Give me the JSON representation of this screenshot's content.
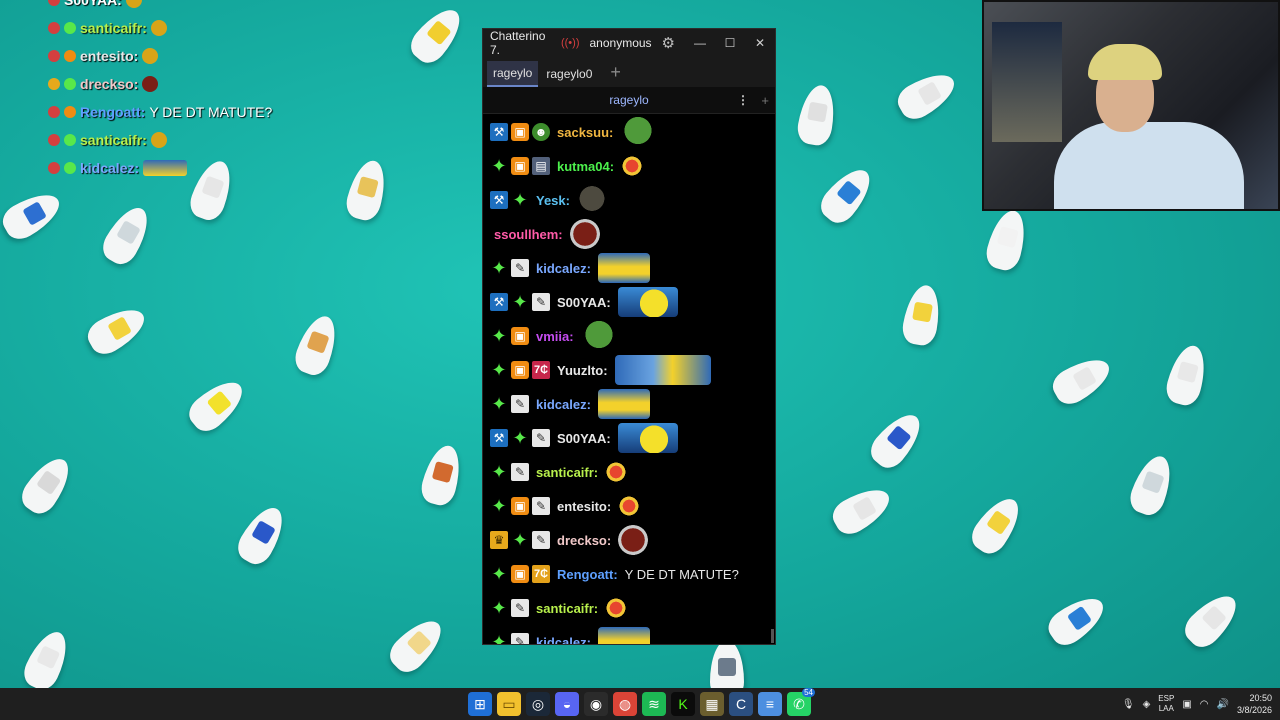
{
  "window": {
    "title": "Chatterino 7.",
    "live_icon": "broadcast-icon",
    "account": "anonymous",
    "minimize": "—",
    "maximize": "☐",
    "close": "✕"
  },
  "tabs": [
    {
      "label": "rageylo",
      "active": true
    },
    {
      "label": "rageylo0",
      "active": false
    }
  ],
  "tab_add": "+",
  "split": {
    "channel": "rageylo",
    "menu": "⋮",
    "add": "+"
  },
  "messages": [
    {
      "badges": [
        "mod",
        "box",
        "frog"
      ],
      "user": "sacksuu:",
      "color": "#f0b640",
      "text": "",
      "emote": "pepe"
    },
    {
      "badges": [
        "sub",
        "box",
        "img"
      ],
      "user": "kutma04:",
      "color": "#4cf04c",
      "text": "",
      "emote": "small"
    },
    {
      "badges": [
        "mod",
        "sub"
      ],
      "user": "Yesk:",
      "color": "#5bc0f0",
      "text": "",
      "emote": "cat"
    },
    {
      "badges": [],
      "user": "ssoullhem:",
      "color": "#ff5ba8",
      "text": "",
      "emote": "cookie"
    },
    {
      "badges": [
        "sub",
        "pencil"
      ],
      "user": "kidcalez:",
      "color": "#7aa8ff",
      "text": "",
      "emote": "minion"
    },
    {
      "badges": [
        "mod",
        "sub",
        "pencil"
      ],
      "user": "S00YAA:",
      "color": "#e8e8e8",
      "text": "",
      "emote": "duck"
    },
    {
      "badges": [
        "sub",
        "box"
      ],
      "user": "vmiia:",
      "color": "#c54cf0",
      "text": "",
      "emote": "pepe"
    },
    {
      "badges": [
        "sub",
        "box",
        "seven"
      ],
      "user": "Yuuzlto:",
      "color": "#e8e8e8",
      "text": "",
      "emote": "wide"
    },
    {
      "badges": [
        "sub",
        "pencil"
      ],
      "user": "kidcalez:",
      "color": "#7aa8ff",
      "text": "",
      "emote": "minion"
    },
    {
      "badges": [
        "mod",
        "sub",
        "pencil"
      ],
      "user": "S00YAA:",
      "color": "#e8e8e8",
      "text": "",
      "emote": "duck"
    },
    {
      "badges": [
        "sub",
        "pencil"
      ],
      "user": "santicaifr:",
      "color": "#b8f04c",
      "text": "",
      "emote": "small"
    },
    {
      "badges": [
        "sub",
        "box",
        "pencil"
      ],
      "user": "entesito:",
      "color": "#e8e8e8",
      "text": "",
      "emote": "small"
    },
    {
      "badges": [
        "crown",
        "sub",
        "pencil"
      ],
      "user": "drecksо:",
      "color": "#f0c8c8",
      "text": "",
      "emote": "cookie"
    },
    {
      "badges": [
        "sub",
        "box",
        "seven2"
      ],
      "user": "Rengoatt:",
      "color": "#5ea0ff",
      "text": "Y DE DT MATUTE?",
      "emote": ""
    },
    {
      "badges": [
        "sub",
        "pencil"
      ],
      "user": "santicaifr:",
      "color": "#b8f04c",
      "text": "",
      "emote": "small"
    },
    {
      "badges": [
        "sub",
        "pencil"
      ],
      "user": "kidcalez:",
      "color": "#7aa8ff",
      "text": "",
      "emote": "minion"
    }
  ],
  "overlay": [
    {
      "user": "S00YAA:",
      "color": "#ffffff",
      "text": ""
    },
    {
      "user": "santicaifr:",
      "color": "#b8f04c",
      "text": ""
    },
    {
      "user": "entesito:",
      "color": "#e8e8e8",
      "text": ""
    },
    {
      "user": "drecksо:",
      "color": "#f0c8c8",
      "text": ""
    },
    {
      "user": "Rengoatt:",
      "color": "#5ea0ff",
      "text": "Y DE DT MATUTE?"
    },
    {
      "user": "santicaifr:",
      "color": "#b8f04c",
      "text": ""
    },
    {
      "user": "kidcalez:",
      "color": "#7aa8ff",
      "text": ""
    }
  ],
  "taskbar": {
    "icons": [
      "windows-start-icon",
      "file-explorer-icon",
      "steam-icon",
      "discord-icon",
      "obs-icon",
      "chrome-icon",
      "spotify-icon",
      "kick-icon",
      "game-icon",
      "chatterino-icon",
      "notepad-icon",
      "whatsapp-icon"
    ],
    "whatsapp_badge": "54",
    "lang_top": "ESP",
    "lang_bottom": "LAA",
    "time": "20:50",
    "date": "3/8/2026"
  },
  "colors": {
    "accent": "#6a86c9",
    "desktop": "#14a79c"
  }
}
